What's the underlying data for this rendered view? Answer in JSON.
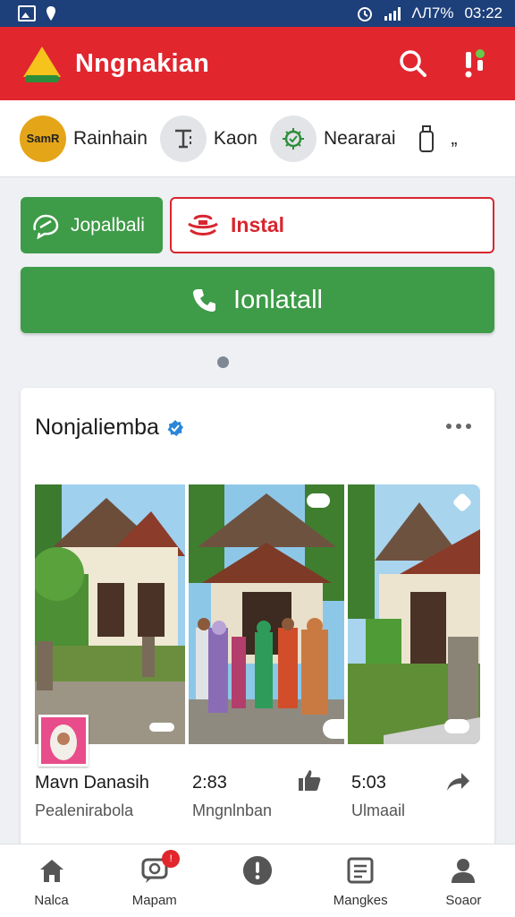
{
  "status_bar": {
    "battery_text": "ΛЛ7%",
    "time": "03:22"
  },
  "app_bar": {
    "title": "Nngnakian",
    "brand_color": "#e1262e"
  },
  "stories": [
    {
      "avatar_text": "SamR",
      "label": "Rainhain",
      "icon": "sam-avatar-icon"
    },
    {
      "avatar_text": "",
      "label": "Kaon",
      "icon": "text-tool-icon"
    },
    {
      "avatar_text": "",
      "label": "Neararai",
      "icon": "badge-icon"
    },
    {
      "avatar_text": "",
      "label": "„",
      "icon": "bottle-icon"
    }
  ],
  "buttons": {
    "joinbali_label": "Jopalbali",
    "instal_label": "Instal",
    "install_main_label": "Ionlatall"
  },
  "post": {
    "title": "Nonjaliemba",
    "columns": [
      {
        "title": "Mavn Danasih",
        "subtitle": "Pealenirabola"
      },
      {
        "title": "2:83",
        "subtitle": "Mngnlnban"
      },
      {
        "title": "5:03",
        "subtitle": "Ulmaail"
      }
    ]
  },
  "bottom_nav": {
    "items": [
      {
        "label": "Nalca",
        "icon": "home-icon"
      },
      {
        "label": "Mapam",
        "icon": "chat-icon",
        "badge": "!"
      },
      {
        "label": "",
        "icon": "alert-circle-icon"
      },
      {
        "label": "Mangkes",
        "icon": "document-icon"
      },
      {
        "label": "Soaor",
        "icon": "profile-icon"
      }
    ]
  }
}
